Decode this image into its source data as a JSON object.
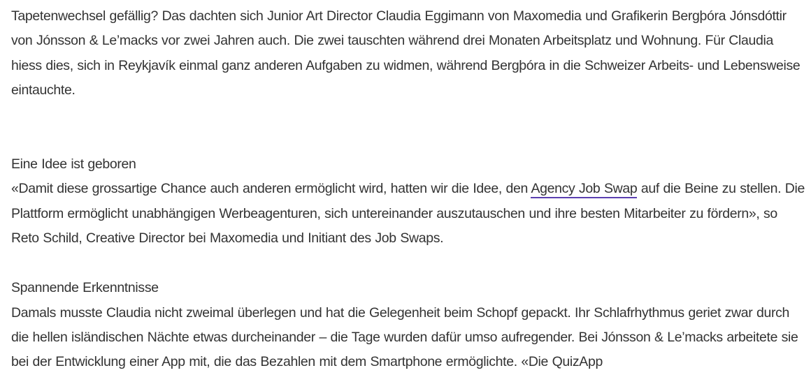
{
  "article": {
    "intro": "Tapetenwechsel gefällig? Das dachten sich Junior Art Director Claudia Eggimann von Maxomedia und Grafikerin Bergþóra Jónsdóttir von Jónsson & Le’macks vor zwei Jahren auch. Die zwei tauschten während drei Monaten Arbeitsplatz und Wohnung. Für Claudia hiess dies, sich in Reykjavík einmal ganz anderen Aufgaben zu widmen, während Bergþóra in die Schweizer Arbeits- und Lebensweise eintauchte.",
    "sections": [
      {
        "heading": "Eine Idee ist geboren",
        "text_before_link": "«Damit diese grossartige Chance auch anderen ermöglicht wird, hatten wir die Idee, den ",
        "link_text": "Agency Job Swap",
        "text_after_link": " auf die Beine zu stellen. Die Plattform ermöglicht unabhängigen Werbeagenturen, sich untereinander auszutauschen und ihre besten Mitarbeiter zu fördern», so Reto Schild, Creative Director bei Maxomedia und Initiant des Job Swaps."
      },
      {
        "heading": "Spannende Erkenntnisse",
        "text": "Damals musste Claudia nicht zweimal überlegen und hat die Gelegenheit beim Schopf gepackt. Ihr Schlafrhythmus geriet zwar durch die hellen isländischen Nächte etwas durcheinander – die Tage wurden dafür umso aufregender. Bei Jónsson & Le’macks arbeitete sie bei der Entwicklung einer App mit, die das Bezahlen mit dem Smartphone ermöglichte. «Die QuizApp"
      }
    ]
  },
  "colors": {
    "text": "#333333",
    "link_underline": "#5b3fb0",
    "background": "#ffffff"
  }
}
